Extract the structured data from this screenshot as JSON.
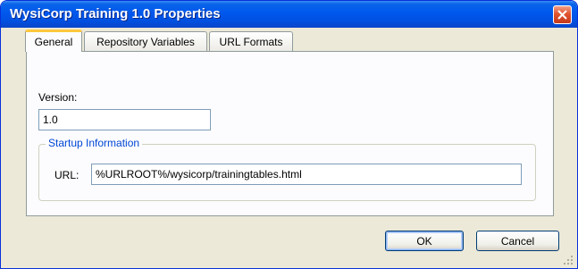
{
  "window": {
    "title": "WysiCorp Training 1.0 Properties"
  },
  "tabs": [
    {
      "label": "General",
      "active": true
    },
    {
      "label": "Repository Variables",
      "active": false
    },
    {
      "label": "URL Formats",
      "active": false
    }
  ],
  "general": {
    "version_label": "Version:",
    "version_value": "1.0",
    "startup_group_title": "Startup Information",
    "url_label": "URL:",
    "url_value": "%URLROOT%/wysicorp/trainingtables.html"
  },
  "buttons": {
    "ok": "OK",
    "cancel": "Cancel"
  },
  "icons": {
    "close": "close-x-icon",
    "grip": "resize-grip-icon"
  },
  "colors": {
    "titlebar": "#0058ee",
    "group_title": "#0046d5",
    "active_tab_accent": "#ffc83c"
  }
}
